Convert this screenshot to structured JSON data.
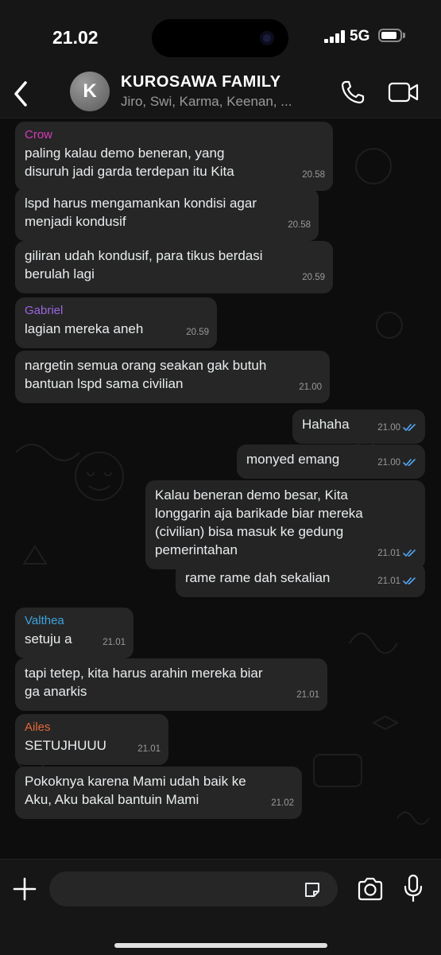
{
  "status_bar": {
    "time": "21.02",
    "network": "5G",
    "battery_level": 0.85
  },
  "header": {
    "avatar_letter": "K",
    "title": "KUROSAWA FAMILY",
    "subtitle": "Jiro, Swi, Karma, Keenan, ..."
  },
  "colors": {
    "crow": "#d63ab8",
    "gabriel": "#9b66e0",
    "valthea": "#3ca4dd",
    "ailes": "#e2673a",
    "read_tick": "#53a6f2"
  },
  "messages": [
    {
      "dir": "in",
      "sender": "Crow",
      "sender_color": "#d63ab8",
      "lines": [
        "paling kalau demo beneran, yang",
        "disuruh jadi garda terdepan itu Kita"
      ],
      "time": "20.58"
    },
    {
      "dir": "in",
      "lines": [
        "lspd harus mengamankan kondisi agar",
        "menjadi kondusif"
      ],
      "time": "20.58"
    },
    {
      "dir": "in",
      "lines": [
        "giliran udah kondusif, para tikus berdasi",
        "berulah lagi"
      ],
      "time": "20.59"
    },
    {
      "dir": "in",
      "sender": "Gabriel",
      "sender_color": "#9b66e0",
      "lines": [
        "lagian mereka aneh"
      ],
      "time": "20.59"
    },
    {
      "dir": "in",
      "lines": [
        "nargetin semua orang seakan gak butuh",
        "bantuan lspd sama civilian"
      ],
      "time": "21.00"
    },
    {
      "dir": "out",
      "lines": [
        "Hahaha"
      ],
      "time": "21.00"
    },
    {
      "dir": "out",
      "lines": [
        "monyed emang"
      ],
      "time": "21.00"
    },
    {
      "dir": "out",
      "lines": [
        "Kalau beneran demo besar, Kita",
        "longgarin aja barikade biar mereka",
        "(civilian) bisa masuk ke gedung",
        "pemerintahan"
      ],
      "time": "21.01"
    },
    {
      "dir": "out",
      "lines": [
        "rame rame dah sekalian"
      ],
      "time": "21.01"
    },
    {
      "dir": "in",
      "sender": "Valthea",
      "sender_color": "#3ca4dd",
      "lines": [
        "setuju a"
      ],
      "time": "21.01"
    },
    {
      "dir": "in",
      "lines": [
        "tapi tetep, kita harus arahin mereka biar",
        "ga anarkis"
      ],
      "time": "21.01"
    },
    {
      "dir": "in",
      "sender": "Ailes",
      "sender_color": "#e2673a",
      "lines": [
        "SETUJHUUU"
      ],
      "time": "21.01"
    },
    {
      "dir": "in",
      "lines": [
        "Pokoknya karena Mami udah baik ke",
        "Aku, Aku bakal bantuin Mami"
      ],
      "time": "21.02"
    }
  ],
  "composer": {
    "placeholder": ""
  }
}
